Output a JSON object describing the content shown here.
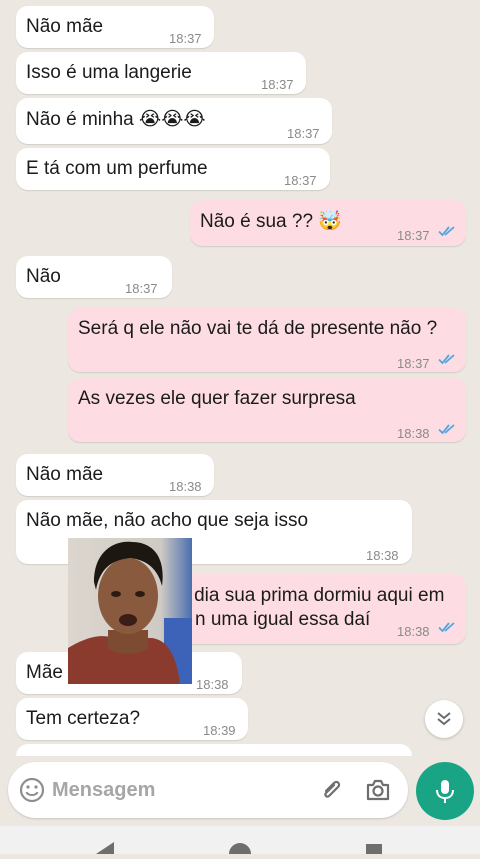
{
  "messages": [
    {
      "text": "Não mãe",
      "time": "18:37"
    },
    {
      "text": "Isso é uma langerie",
      "time": "18:37"
    },
    {
      "text": "Não é minha 😭😭😭",
      "time": "18:37"
    },
    {
      "text": "E tá com um perfume",
      "time": "18:37"
    },
    {
      "text": "Não é sua ?? 🤯",
      "time": "18:37"
    },
    {
      "text": "Não",
      "time": "18:37"
    },
    {
      "text": "Será q ele não vai te dá de presente não ?",
      "time": "18:37"
    },
    {
      "text": "As vezes ele quer fazer surpresa",
      "time": "18:38"
    },
    {
      "text": "Não mãe",
      "time": "18:38"
    },
    {
      "text": "Não mãe, não acho que seja isso",
      "time": "18:38"
    },
    {
      "line1": "m dia sua prima dormiu aqui em",
      "line2": "n uma igual essa daí",
      "time": "18:38"
    },
    {
      "text": "Mãe",
      "time": "18:38"
    },
    {
      "text": "Tem certeza?",
      "time": "18:39"
    }
  ],
  "composer": {
    "placeholder": "Mensagem"
  },
  "icons": {
    "emoji": "emoji-icon",
    "attach": "paperclip-icon",
    "camera": "camera-icon",
    "mic": "mic-icon",
    "scroll": "double-chevron-down-icon",
    "ticks": "double-check-icon"
  },
  "colors": {
    "incoming": "#ffffff",
    "outgoing": "#fddde3",
    "read_ticks": "#4fa8e0",
    "mic_button": "#1aa486"
  }
}
